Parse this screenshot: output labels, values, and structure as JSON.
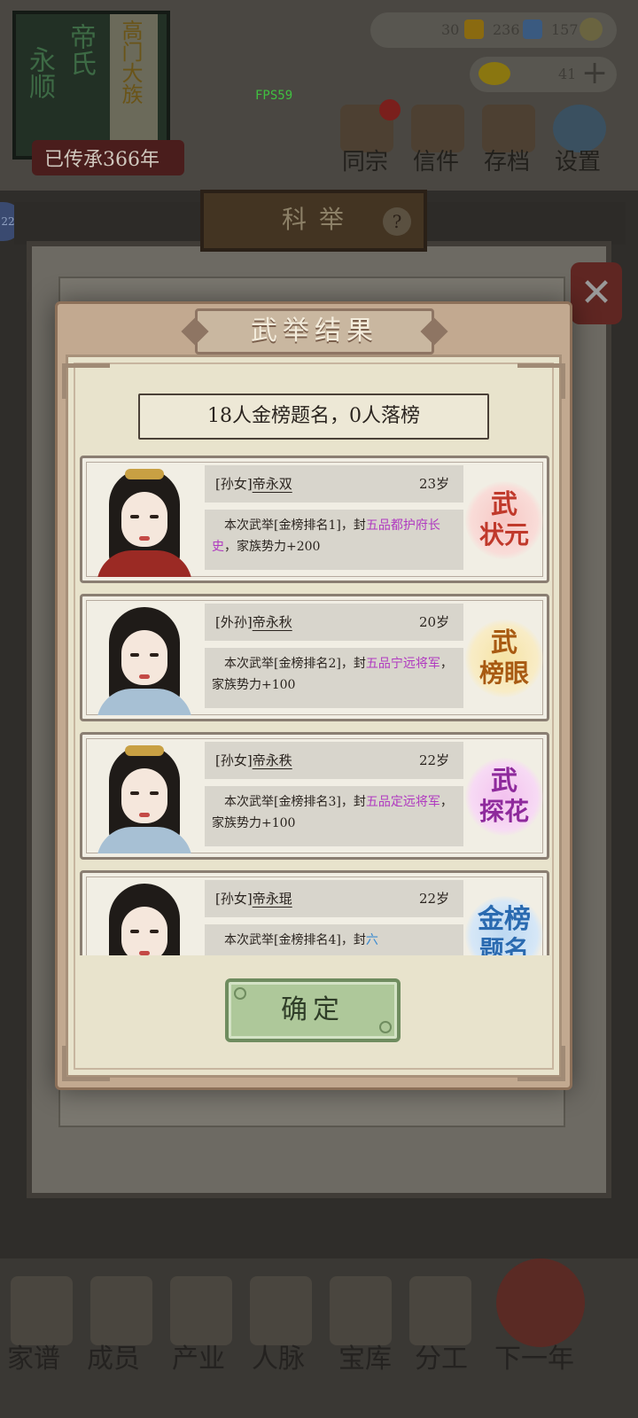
{
  "hud": {
    "family_name": "永顺",
    "clan_name": "帝氏",
    "dynasty_tag": "高门大族",
    "legacy": "已传承366年",
    "fps": "FPS59",
    "resource_1": "30",
    "resource_2": "236",
    "resource_3": "157",
    "ingot": "41",
    "buttons": {
      "clan": "同宗",
      "mail": "信件",
      "save": "存档",
      "settings": "设置"
    },
    "side_badge": "22"
  },
  "exam_panel": {
    "title": "科举",
    "help": "?",
    "close": "✕"
  },
  "bottom_nav": {
    "genealogy": "家谱",
    "members": "成员",
    "industry": "产业",
    "network": "人脉",
    "treasury": "宝库",
    "assign": "分工",
    "next_year": "下一年"
  },
  "modal": {
    "title": "武举结果",
    "summary": "18人金榜题名，0人落榜",
    "confirm": "确定",
    "results": [
      {
        "relation": "[孙女]",
        "name": "帝永双",
        "age": "23岁",
        "desc_prefix": "本次武举[金榜排名1]，封",
        "rank_prefix": "五品",
        "office": "都护府长史",
        "desc_suffix": "，家族势力+200",
        "seal_line1": "武",
        "seal_line2": "状元"
      },
      {
        "relation": "[外孙]",
        "name": "帝永秋",
        "age": "20岁",
        "desc_prefix": "本次武举[金榜排名2]，封",
        "rank_prefix": "五品",
        "office": "宁远将军",
        "desc_suffix": "，家族势力+100",
        "seal_line1": "武",
        "seal_line2": "榜眼"
      },
      {
        "relation": "[孙女]",
        "name": "帝永秩",
        "age": "22岁",
        "desc_prefix": "本次武举[金榜排名3]，封",
        "rank_prefix": "五品",
        "office": "定远将军",
        "desc_suffix": "，家族势力+100",
        "seal_line1": "武",
        "seal_line2": "探花"
      },
      {
        "relation": "[孙女]",
        "name": "帝永琨",
        "age": "22岁",
        "desc_prefix": "本次武举[金榜排名4]，封",
        "rank_prefix": "六",
        "seal_line1": "金榜",
        "seal_line2": "题名"
      }
    ]
  },
  "colors": {
    "modal_bg": "#c2a990",
    "paper": "#e8e3cc",
    "highlight_purple": "#b03ac0",
    "highlight_blue": "#3a8ad0",
    "confirm_green": "#aec89a"
  }
}
